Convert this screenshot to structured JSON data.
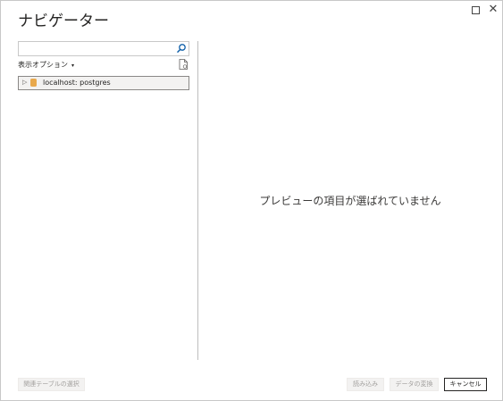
{
  "window": {
    "title": "ナビゲーター",
    "maximize_icon": "maximize-icon",
    "close_icon": "close-icon",
    "close_glyph": "✕"
  },
  "search": {
    "value": "",
    "placeholder": "",
    "icon": "search-icon"
  },
  "display_options": {
    "label": "表示オプション",
    "caret": "▾"
  },
  "toolbar": {
    "file_icon": "document-refresh-icon"
  },
  "tree": {
    "items": [
      {
        "label": "localhost: postgres",
        "expander": "▷",
        "icon": "database-icon",
        "selected": true
      }
    ]
  },
  "preview": {
    "empty_message": "プレビューの項目が選ばれていません"
  },
  "footer": {
    "related_tables_label": "関連テーブルの選択",
    "load_label": "読み込み",
    "transform_label": "データの変換",
    "cancel_label": "キャンセル"
  },
  "colors": {
    "db_icon": "#e8a84c",
    "accent": "#252423",
    "disabled_text": "#a19f9d"
  }
}
